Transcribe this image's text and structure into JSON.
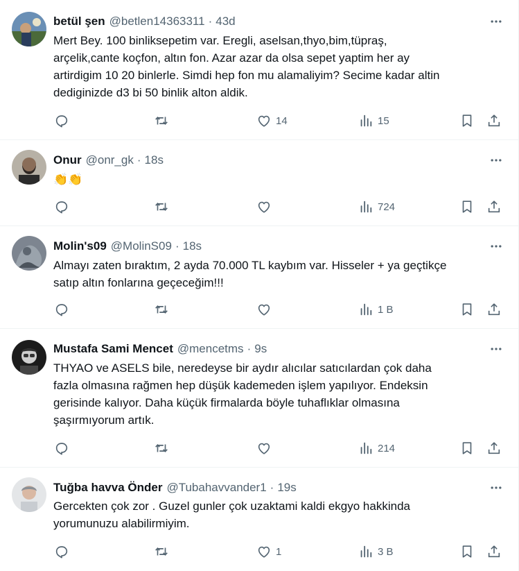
{
  "tweets": [
    {
      "name": "betül şen",
      "handle": "@betlen14363311",
      "time": "43d",
      "lines": [
        "Mert Bey. 100 binliksepetim var. Eregli, aselsan,thyo,bim,tüpraş,",
        "arçelik,cante koçfon, altın fon. Azar azar da olsa sepet yaptim her ay",
        "artirdigim 10 20 binlerle. Simdi hep fon mu alamaliyim?  Secime kadar altin",
        "dediginizde d3 bi 50 binlik alton aldik."
      ],
      "replies": "",
      "retweets": "",
      "likes": "14",
      "views": "15"
    },
    {
      "name": "Onur",
      "handle": "@onr_gk",
      "time": "18s",
      "lines": [
        "👏👏"
      ],
      "replies": "",
      "retweets": "",
      "likes": "",
      "views": "724"
    },
    {
      "name": "Molin's09",
      "handle": "@MolinS09",
      "time": "18s",
      "lines": [
        "Almayı zaten bıraktım, 2 ayda 70.000 TL kaybım var. Hisseler + ya geçtikçe",
        "satıp altın fonlarına geçeceğim!!!"
      ],
      "replies": "",
      "retweets": "",
      "likes": "",
      "views": "1 B"
    },
    {
      "name": "Mustafa Sami Mencet",
      "handle": "@mencetms",
      "time": "9s",
      "lines": [
        "THYAO ve ASELS bile, neredeyse bir aydır alıcılar satıcılardan çok daha",
        "fazla olmasına rağmen hep düşük kademeden işlem yapılıyor. Endeksin",
        "gerisinde kalıyor. Daha küçük firmalarda böyle tuhaflıklar olmasına",
        "şaşırmıyorum artık."
      ],
      "replies": "",
      "retweets": "",
      "likes": "",
      "views": "214"
    },
    {
      "name": "Tuğba havva Önder",
      "handle": "@Tubahavvander1",
      "time": "19s",
      "lines": [
        "Gercekten çok zor .  Guzel gunler çok uzaktami kaldi ekgyo hakkinda",
        "yorumunuzu alabilirmiyim."
      ],
      "replies": "",
      "retweets": "",
      "likes": "1",
      "views": "3 B"
    }
  ],
  "colors": {
    "text": "#0f1419",
    "secondary": "#536471",
    "divider": "#eff3f4"
  },
  "icons": {
    "reply": "reply-icon",
    "retweet": "retweet-icon",
    "like": "heart-icon",
    "views": "views-icon",
    "bookmark": "bookmark-icon",
    "share": "share-icon",
    "more": "more-icon"
  }
}
